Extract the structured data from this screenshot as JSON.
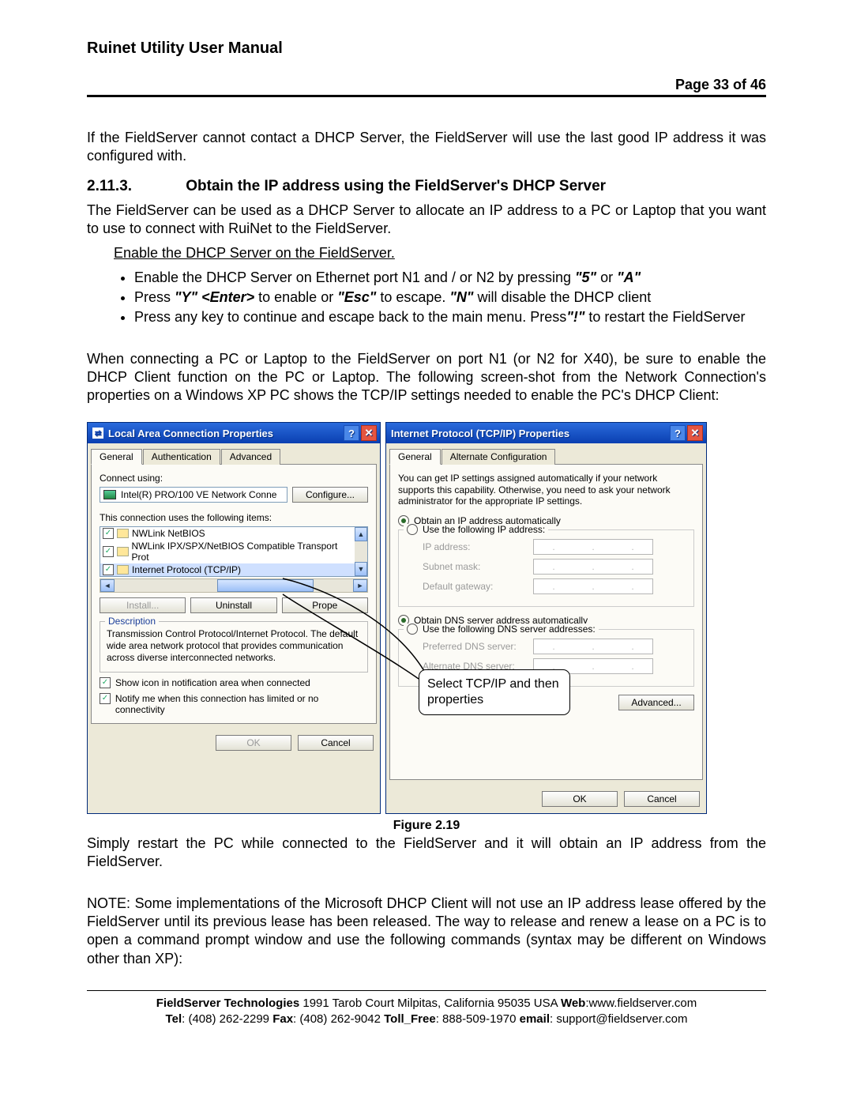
{
  "doc_title": "Ruinet Utility User Manual",
  "page_indicator": "Page 33 of 46",
  "para1": "If the FieldServer cannot contact a DHCP Server, the FieldServer will use the last good IP address it was configured with.",
  "section_number": "2.11.3.",
  "section_title": "Obtain the IP address using the FieldServer's DHCP Server",
  "para2": "The FieldServer can be used as a DHCP Server to allocate an IP address to a PC or Laptop that you want to use to connect with RuiNet to the FieldServer.",
  "enable_line": "Enable the DHCP Server on the FieldServer.",
  "bullets": {
    "b1_pre": "Enable the DHCP Server on Ethernet port N1 and / or N2 by pressing ",
    "b1_5": "\"5\"",
    "b1_or": " or ",
    "b1_A": "\"A\"",
    "b2_pre": "Press ",
    "b2_Y": "\"Y\" <Enter>",
    "b2_mid1": " to enable or ",
    "b2_Esc": "\"Esc\"",
    "b2_mid2": " to escape.   ",
    "b2_N": "\"N\"",
    "b2_post": " will disable the DHCP client",
    "b3_pre": "Press any key to continue and escape back to the main menu.  Press",
    "b3_excl": "\"!\"",
    "b3_post": " to restart the FieldServer"
  },
  "para3": "When connecting a PC or Laptop to the FieldServer on port N1 (or N2 for X40), be sure to enable the DHCP Client function on the PC or Laptop. The following screen-shot from the Network Connection's properties on a Windows XP PC shows the TCP/IP settings needed to enable the PC's DHCP Client:",
  "figure_caption": "Figure 2.19",
  "para4": "Simply restart the PC while connected to the FieldServer and it will obtain an IP address from the FieldServer.",
  "para5": "NOTE: Some implementations of the Microsoft DHCP Client will not use an IP address lease offered by the FieldServer until its previous lease has been released.  The way to release and renew a lease on a PC is to open a command prompt window and use the following commands (syntax may be different on Windows other than XP):",
  "footer": {
    "line1_pre": "FieldServer Technologies",
    "line1_addr": " 1991 Tarob Court Milpitas, California 95035 USA  ",
    "line1_web_lbl": "Web",
    "line1_web": ":www.fieldserver.com",
    "tel_lbl": "Tel",
    "tel": ": (408) 262-2299   ",
    "fax_lbl": "Fax",
    "fax": ": (408) 262-9042   ",
    "tf_lbl": "Toll_Free",
    "tf": ": 888-509-1970   ",
    "em_lbl": "email",
    "em": ": support@fieldserver.com"
  },
  "dlg_left": {
    "title": "Local Area Connection Properties",
    "tabs": {
      "t1": "General",
      "t2": "Authentication",
      "t3": "Advanced"
    },
    "connect_label": "Connect using:",
    "nic": "Intel(R) PRO/100 VE Network Conne",
    "configure": "Configure...",
    "uses_label": "This connection uses the following items:",
    "items": {
      "i1": "NWLink NetBIOS",
      "i2": "NWLink IPX/SPX/NetBIOS Compatible Transport Prot",
      "i3": "Internet Protocol (TCP/IP)"
    },
    "install": "Install...",
    "uninstall": "Uninstall",
    "properties": "Prope",
    "desc_label": "Description",
    "desc": "Transmission Control Protocol/Internet Protocol. The default wide area network protocol that provides communication across diverse interconnected networks.",
    "chk_show": "Show icon in notification area when connected",
    "chk_notify": "Notify me when this connection has limited or no connectivity",
    "ok": "OK",
    "cancel": "Cancel"
  },
  "dlg_right": {
    "title": "Internet Protocol (TCP/IP) Properties",
    "tabs": {
      "t1": "General",
      "t2": "Alternate Configuration"
    },
    "info": "You can get IP settings assigned automatically if your network supports this capability. Otherwise, you need to ask your network administrator for the appropriate IP settings.",
    "r1": "Obtain an IP address automatically",
    "r2": "Use the following IP address:",
    "ip_label": "IP address:",
    "sn_label": "Subnet mask:",
    "gw_label": "Default gateway:",
    "r3": "Obtain DNS server address automatically",
    "r4": "Use the following DNS server addresses:",
    "pdns_label": "Preferred DNS server:",
    "adns_label": "Alternate DNS server:",
    "advanced": "Advanced...",
    "ok": "OK",
    "cancel": "Cancel"
  },
  "callout": "Select TCP/IP and then properties"
}
